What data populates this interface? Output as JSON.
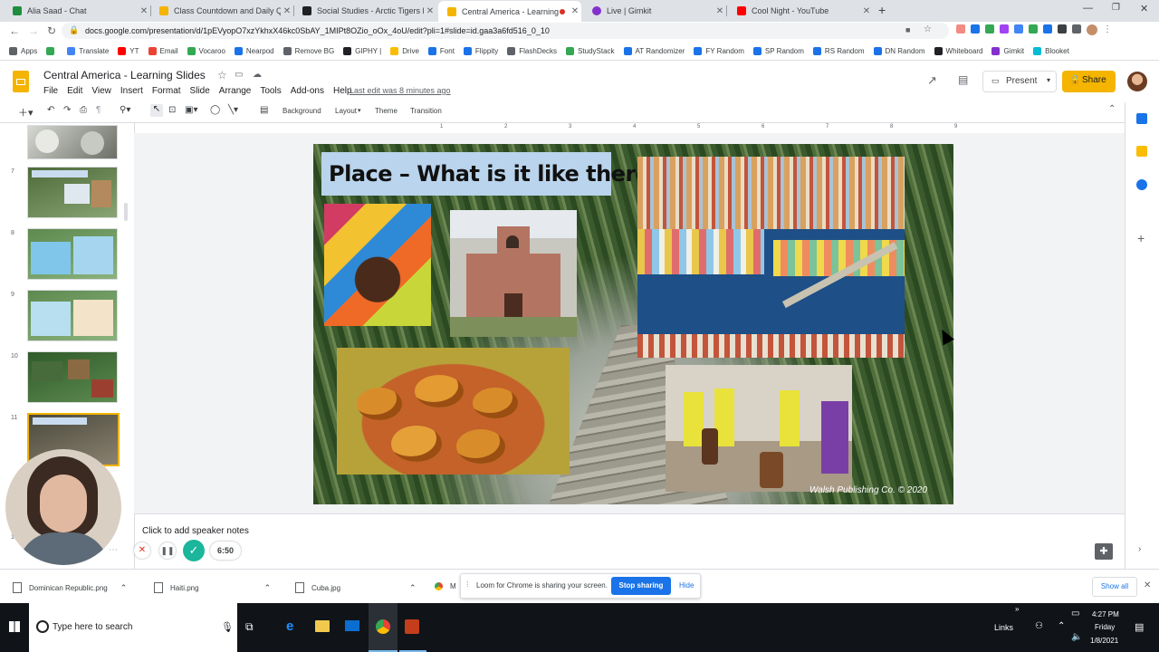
{
  "browser": {
    "tabs": [
      {
        "title": "Alia Saad - Chat",
        "color": "#1e8e3e"
      },
      {
        "title": "Class Countdown and Daily Ques",
        "color": "#f4b400"
      },
      {
        "title": "Social Studies - Arctic Tigers Peri",
        "color": "#202124"
      },
      {
        "title": "Central America - Learning S",
        "color": "#f4b400",
        "active": true
      },
      {
        "title": "Live | Gimkit",
        "color": "#8430ce"
      },
      {
        "title": "Cool Night - YouTube",
        "color": "#ff0000"
      }
    ],
    "new_tab_label": "+",
    "url": "docs.google.com/presentation/d/1pEVyopO7xzYkhxX46kc0SbAY_1MIPt8OZio_oOx_4oU/edit?pli=1#slide=id.gaa3a6fd516_0_10",
    "bookmarks": [
      {
        "label": "Apps",
        "color": "#5f6368"
      },
      {
        "label": "",
        "color": "#34a853"
      },
      {
        "label": "Translate",
        "color": "#4285f4"
      },
      {
        "label": "YT",
        "color": "#ff0000"
      },
      {
        "label": "Email",
        "color": "#ea4335"
      },
      {
        "label": "Vocaroo",
        "color": "#34a853"
      },
      {
        "label": "Nearpod",
        "color": "#1a73e8"
      },
      {
        "label": "Remove BG",
        "color": "#5f6368"
      },
      {
        "label": "GIPHY |",
        "color": "#202124"
      },
      {
        "label": "Drive",
        "color": "#fbbc04"
      },
      {
        "label": "Font",
        "color": "#1a73e8"
      },
      {
        "label": "Flippity",
        "color": "#1a73e8"
      },
      {
        "label": "FlashDecks",
        "color": "#5f6368"
      },
      {
        "label": "StudyStack",
        "color": "#34a853"
      },
      {
        "label": "AT Randomizer",
        "color": "#1a73e8"
      },
      {
        "label": "FY Random",
        "color": "#1a73e8"
      },
      {
        "label": "SP Random",
        "color": "#1a73e8"
      },
      {
        "label": "RS Random",
        "color": "#1a73e8"
      },
      {
        "label": "DN Random",
        "color": "#1a73e8"
      },
      {
        "label": "Whiteboard",
        "color": "#202124"
      },
      {
        "label": "Gimkit",
        "color": "#8430ce"
      },
      {
        "label": "Blooket",
        "color": "#00bcd4"
      }
    ]
  },
  "doc": {
    "title": "Central America - Learning Slides",
    "menu": [
      "File",
      "Edit",
      "View",
      "Insert",
      "Format",
      "Slide",
      "Arrange",
      "Tools",
      "Add-ons",
      "Help"
    ],
    "last_edit": "Last edit was 8 minutes ago",
    "present_label": "Present",
    "share_label": "Share",
    "toolbar_buttons": [
      "Background",
      "Layout",
      "Theme",
      "Transition"
    ],
    "ruler_ticks": [
      "1",
      "2",
      "3",
      "4",
      "5",
      "6",
      "7",
      "8",
      "9"
    ],
    "speaker_notes_placeholder": "Click to add speaker notes"
  },
  "filmstrip": {
    "slide_numbers": [
      "7",
      "8",
      "9",
      "10",
      "11"
    ],
    "partial_number": "13"
  },
  "slide": {
    "title": "Place – What is it like there?",
    "copyright": "Walsh Publishing Co. © 2020"
  },
  "recorder": {
    "timer": "6:50"
  },
  "loom": {
    "message": "Loom for Chrome is sharing your screen.",
    "stop_label": "Stop sharing",
    "hide_label": "Hide"
  },
  "downloads": {
    "items": [
      "Dominican Republic.png",
      "Haiti.png",
      "Cuba.jpg",
      "M"
    ],
    "show_all_label": "Show all"
  },
  "taskbar": {
    "search_placeholder": "Type here to search",
    "links_label": "Links",
    "time": "4:27 PM",
    "day": "Friday",
    "date": "1/8/2021"
  }
}
